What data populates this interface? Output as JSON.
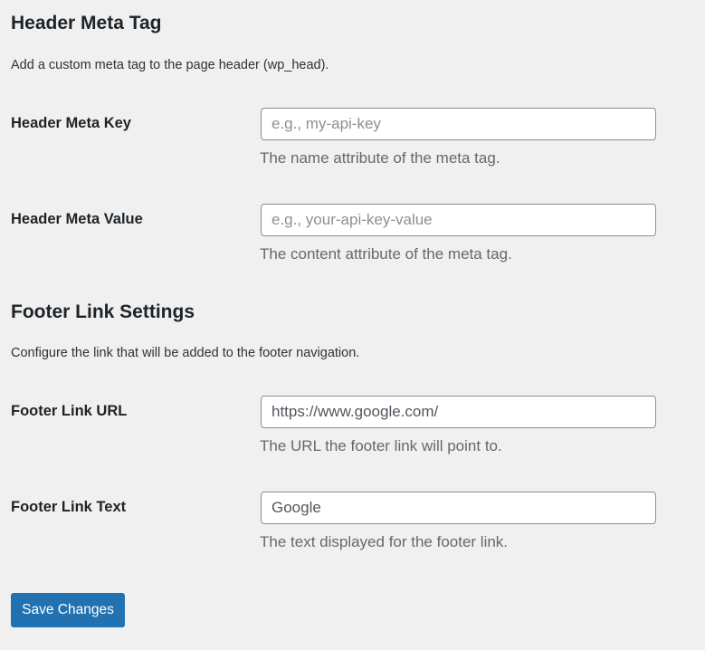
{
  "header_section": {
    "title": "Header Meta Tag",
    "description": "Add a custom meta tag to the page header (wp_head).",
    "fields": [
      {
        "label": "Header Meta Key",
        "value": "",
        "placeholder": "e.g., my-api-key",
        "help": "The name attribute of the meta tag."
      },
      {
        "label": "Header Meta Value",
        "value": "",
        "placeholder": "e.g., your-api-key-value",
        "help": "The content attribute of the meta tag."
      }
    ]
  },
  "footer_section": {
    "title": "Footer Link Settings",
    "description": "Configure the link that will be added to the footer navigation.",
    "fields": [
      {
        "label": "Footer Link URL",
        "value": "https://www.google.com/",
        "placeholder": "",
        "help": "The URL the footer link will point to."
      },
      {
        "label": "Footer Link Text",
        "value": "Google",
        "placeholder": "",
        "help": "The text displayed for the footer link."
      }
    ]
  },
  "submit": {
    "label": "Save Changes"
  },
  "colors": {
    "background": "#f0f0f1",
    "primary_button": "#2271b1",
    "input_border": "#8c8f94",
    "help_text": "#646970"
  }
}
